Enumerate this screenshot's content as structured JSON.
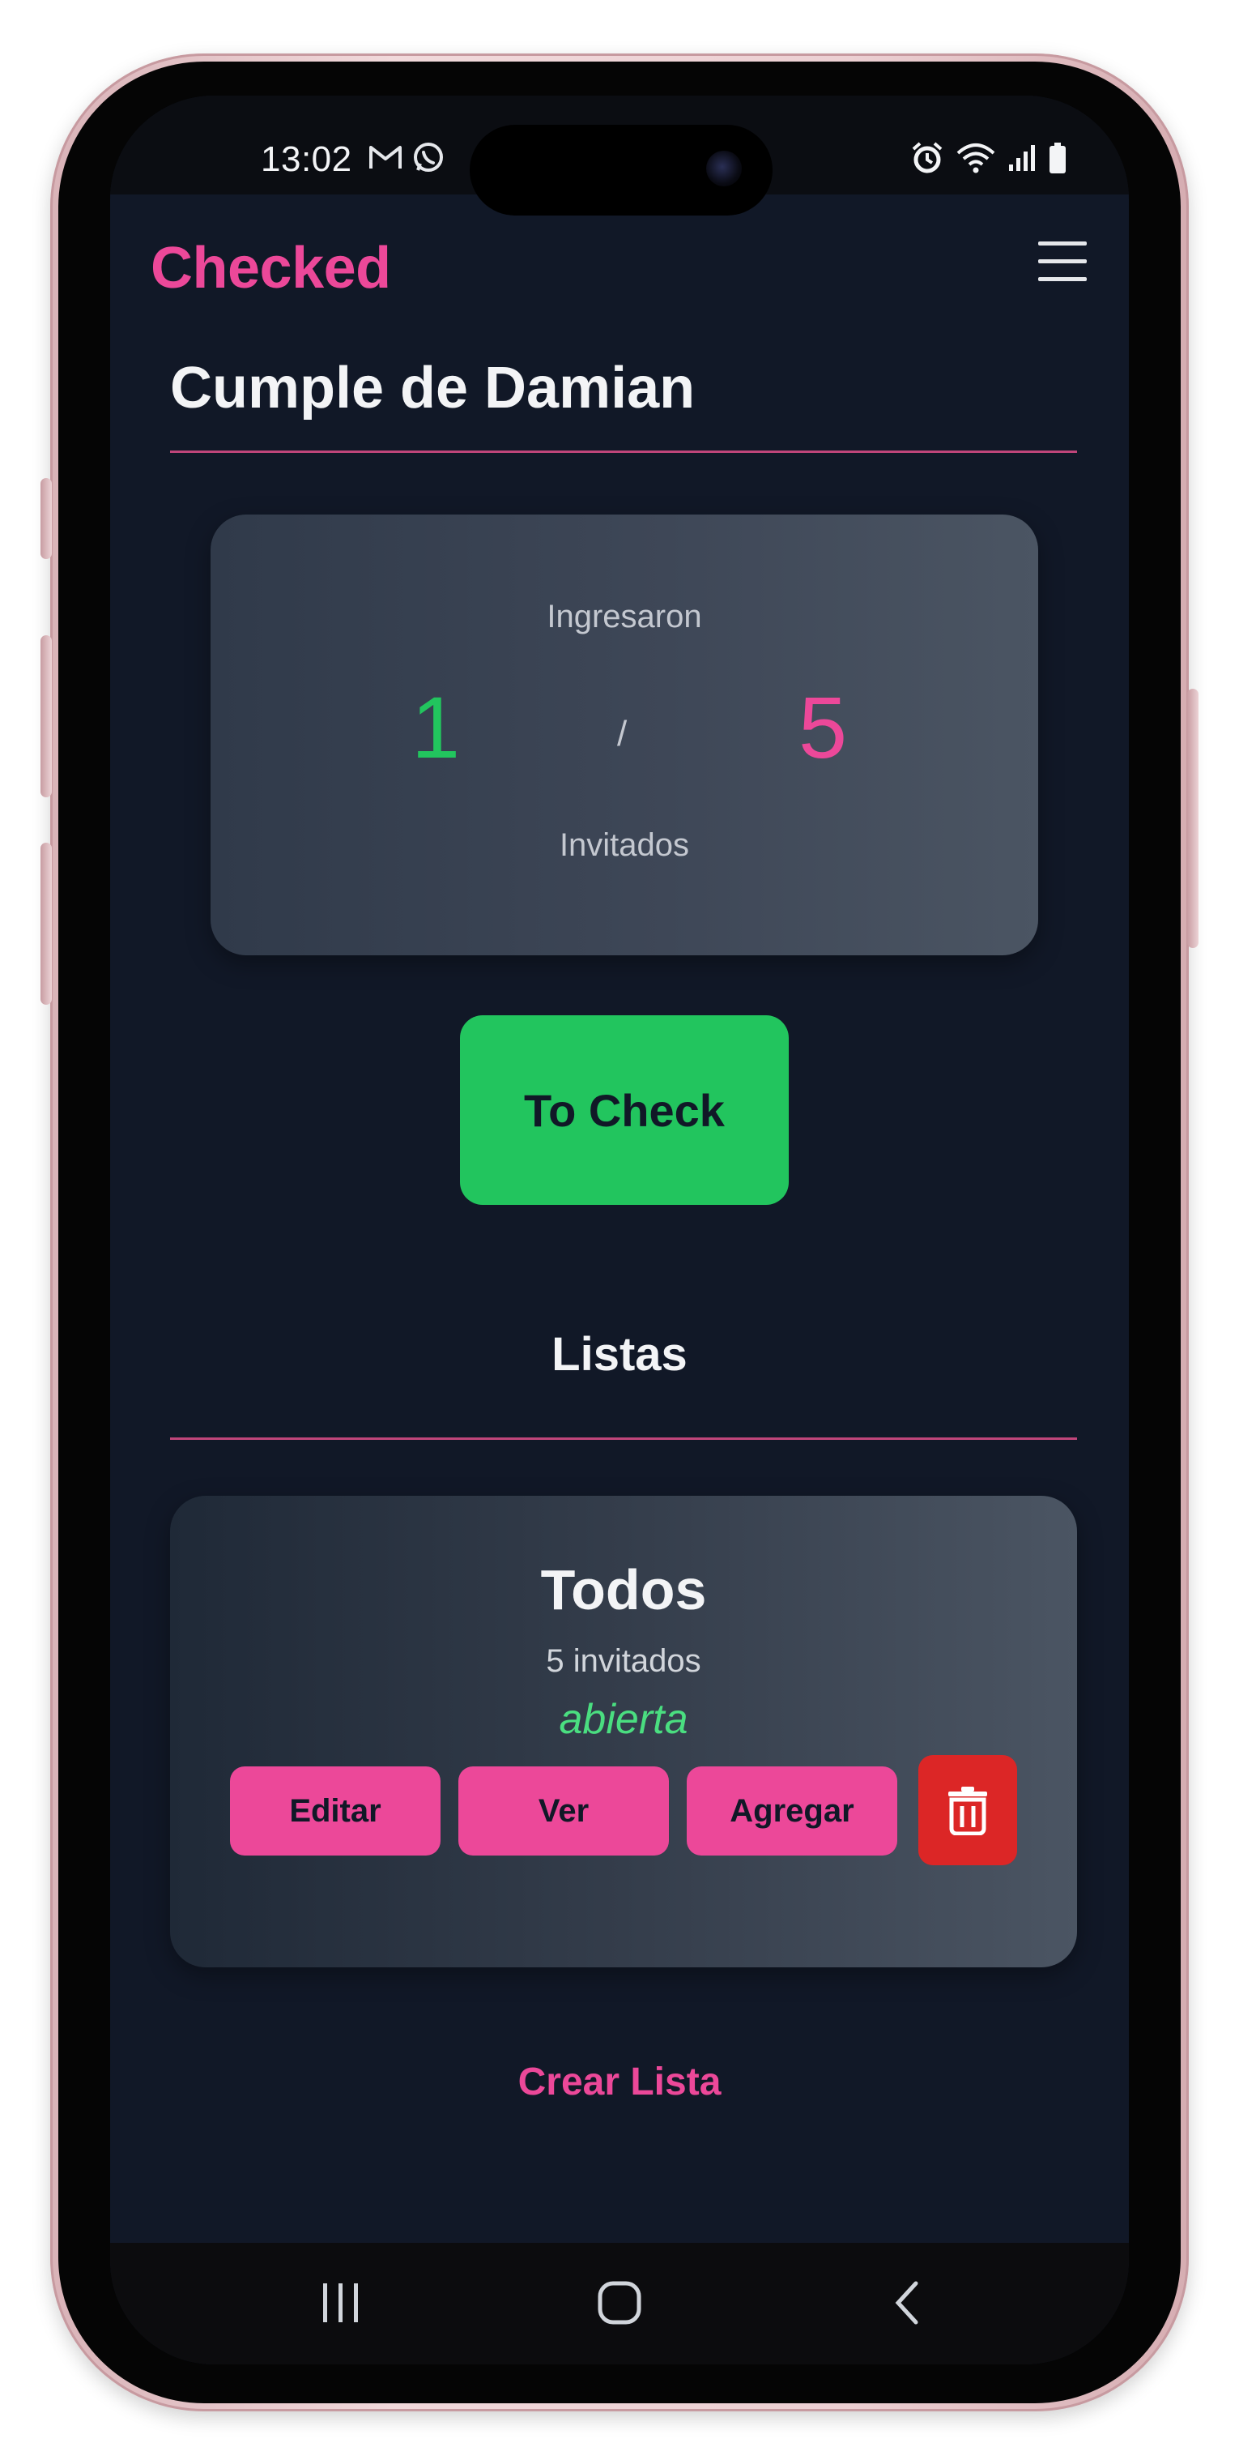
{
  "status_bar": {
    "time": "13:02",
    "left_icons": [
      "gmail-icon",
      "whatsapp-icon"
    ],
    "right_icons": [
      "alarm-icon",
      "wifi-icon",
      "signal-icon",
      "battery-icon"
    ]
  },
  "header": {
    "brand": "Checked",
    "menu_icon": "hamburger-menu-icon"
  },
  "event": {
    "title": "Cumple de Damian"
  },
  "stats": {
    "top_label": "Ingresaron",
    "checked_in": "1",
    "separator": "/",
    "total": "5",
    "bottom_label": "Invitados"
  },
  "actions": {
    "to_check": "To Check"
  },
  "lists_section": {
    "title": "Listas",
    "items": [
      {
        "name": "Todos",
        "count": "5 invitados",
        "status": "abierta",
        "buttons": {
          "edit": "Editar",
          "view": "Ver",
          "add": "Agregar",
          "delete_icon": "trash-icon"
        }
      }
    ],
    "create": "Crear Lista"
  },
  "nav_bar": [
    "recent-apps-icon",
    "home-icon",
    "back-icon"
  ],
  "colors": {
    "background": "#111827",
    "accent": "#ec4899",
    "success": "#22c55e",
    "danger": "#dc2626",
    "card": "#374151"
  }
}
